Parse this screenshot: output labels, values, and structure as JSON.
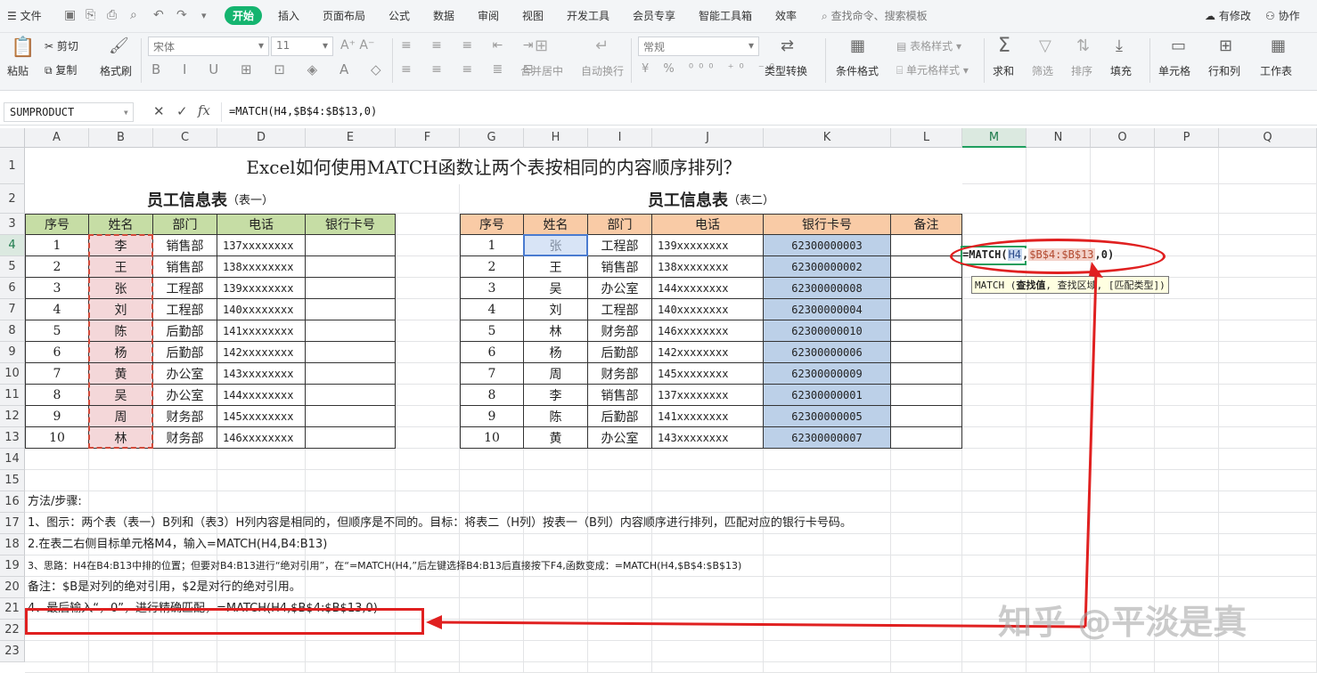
{
  "menubar": {
    "file": "文件",
    "tabs": [
      "开始",
      "插入",
      "页面布局",
      "公式",
      "数据",
      "审阅",
      "视图",
      "开发工具",
      "会员专享",
      "智能工具箱",
      "效率"
    ],
    "search": "查找命令、搜索模板",
    "right": [
      "有修改",
      "协作"
    ]
  },
  "ribbon": {
    "paste": "粘贴",
    "cut": "剪切",
    "copy": "复制",
    "format_painter": "格式刷",
    "font_name": "宋体",
    "font_size": "11",
    "number_format": "常规",
    "merge": "合并居中",
    "wrap": "自动换行",
    "convert": "类型转换",
    "cond_format": "条件格式",
    "table_style": "表格样式",
    "cell_style": "单元格样式",
    "sum": "求和",
    "filter": "筛选",
    "sort": "排序",
    "fill": "填充",
    "cells": "单元格",
    "rowcol": "行和列",
    "sheet": "工作表"
  },
  "formulabar": {
    "namebox": "SUMPRODUCT",
    "fx": "fx",
    "formula": "=MATCH(H4,$B$4:$B$13,0)"
  },
  "columns": [
    "A",
    "B",
    "C",
    "D",
    "E",
    "F",
    "G",
    "H",
    "I",
    "J",
    "K",
    "L",
    "M",
    "N",
    "O",
    "P",
    "Q"
  ],
  "rows": [
    "1",
    "2",
    "3",
    "4",
    "5",
    "6",
    "7",
    "8",
    "9",
    "10",
    "11",
    "12",
    "13",
    "14",
    "15",
    "16",
    "17",
    "18",
    "19",
    "20",
    "21",
    "22",
    "23"
  ],
  "sheet": {
    "title": "Excel如何使用MATCH函数让两个表按相同的内容顺序排列？",
    "table1": {
      "title": "员工信息表",
      "subtitle": "（表一）",
      "headers": [
        "序号",
        "姓名",
        "部门",
        "电话",
        "银行卡号"
      ],
      "rows": [
        [
          "1",
          "李",
          "销售部",
          "137xxxxxxxx",
          ""
        ],
        [
          "2",
          "王",
          "销售部",
          "138xxxxxxxx",
          ""
        ],
        [
          "3",
          "张",
          "工程部",
          "139xxxxxxxx",
          ""
        ],
        [
          "4",
          "刘",
          "工程部",
          "140xxxxxxxx",
          ""
        ],
        [
          "5",
          "陈",
          "后勤部",
          "141xxxxxxxx",
          ""
        ],
        [
          "6",
          "杨",
          "后勤部",
          "142xxxxxxxx",
          ""
        ],
        [
          "7",
          "黄",
          "办公室",
          "143xxxxxxxx",
          ""
        ],
        [
          "8",
          "吴",
          "办公室",
          "144xxxxxxxx",
          ""
        ],
        [
          "9",
          "周",
          "财务部",
          "145xxxxxxxx",
          ""
        ],
        [
          "10",
          "林",
          "财务部",
          "146xxxxxxxx",
          ""
        ]
      ]
    },
    "table2": {
      "title": "员工信息表",
      "subtitle": "（表二）",
      "headers": [
        "序号",
        "姓名",
        "部门",
        "电话",
        "银行卡号",
        "备注"
      ],
      "rows": [
        [
          "1",
          "张",
          "工程部",
          "139xxxxxxxx",
          "62300000003",
          ""
        ],
        [
          "2",
          "王",
          "销售部",
          "138xxxxxxxx",
          "62300000002",
          ""
        ],
        [
          "3",
          "吴",
          "办公室",
          "144xxxxxxxx",
          "62300000008",
          ""
        ],
        [
          "4",
          "刘",
          "工程部",
          "140xxxxxxxx",
          "62300000004",
          ""
        ],
        [
          "5",
          "林",
          "财务部",
          "146xxxxxxxx",
          "62300000010",
          ""
        ],
        [
          "6",
          "杨",
          "后勤部",
          "142xxxxxxxx",
          "62300000006",
          ""
        ],
        [
          "7",
          "周",
          "财务部",
          "145xxxxxxxx",
          "62300000009",
          ""
        ],
        [
          "8",
          "李",
          "销售部",
          "137xxxxxxxx",
          "62300000001",
          ""
        ],
        [
          "9",
          "陈",
          "后勤部",
          "141xxxxxxxx",
          "62300000005",
          ""
        ],
        [
          "10",
          "黄",
          "办公室",
          "143xxxxxxxx",
          "62300000007",
          ""
        ]
      ]
    },
    "editing": {
      "prefix": "=MATCH(",
      "arg1": "H4",
      "sep": ",",
      "arg2": "$B$4:$B$13",
      "suffix": ",0)"
    },
    "tooltip": {
      "fn": "MATCH (",
      "bold": "查找值",
      "rest": ", 查找区域, [匹配类型])"
    },
    "notes": [
      "方法/步骤:",
      "1、图示：两个表（表一）B列和（表3）H列内容是相同的，但顺序是不同的。目标：将表二（H列）按表一（B列）内容顺序进行排列，匹配对应的银行卡号码。",
      "2.在表二右侧目标单元格M4，输入=MATCH(H4,B4:B13)",
      "3、思路：H4在B4:B13中排的位置；但要对B4:B13进行“绝对引用”，在“=MATCH(H4,”后左键选择B4:B13后直接按下F4,函数变成：=MATCH(H4,$B$4:$B$13)",
      "备注：$B是对列的绝对引用，$2是对行的绝对引用。",
      "4、最后输入“，0”，进行精确匹配，=MATCH(H4,$B$4:$B$13,0)"
    ],
    "watermark": "知乎 @平淡是真"
  },
  "colors": {
    "accent": "#14b46f",
    "table1_header": "#c6dda5",
    "table2_header": "#f9cba6",
    "name_col_fill": "#f4d7d9",
    "bank_col_fill": "#bcd0e8",
    "annotation_red": "#e02020"
  }
}
